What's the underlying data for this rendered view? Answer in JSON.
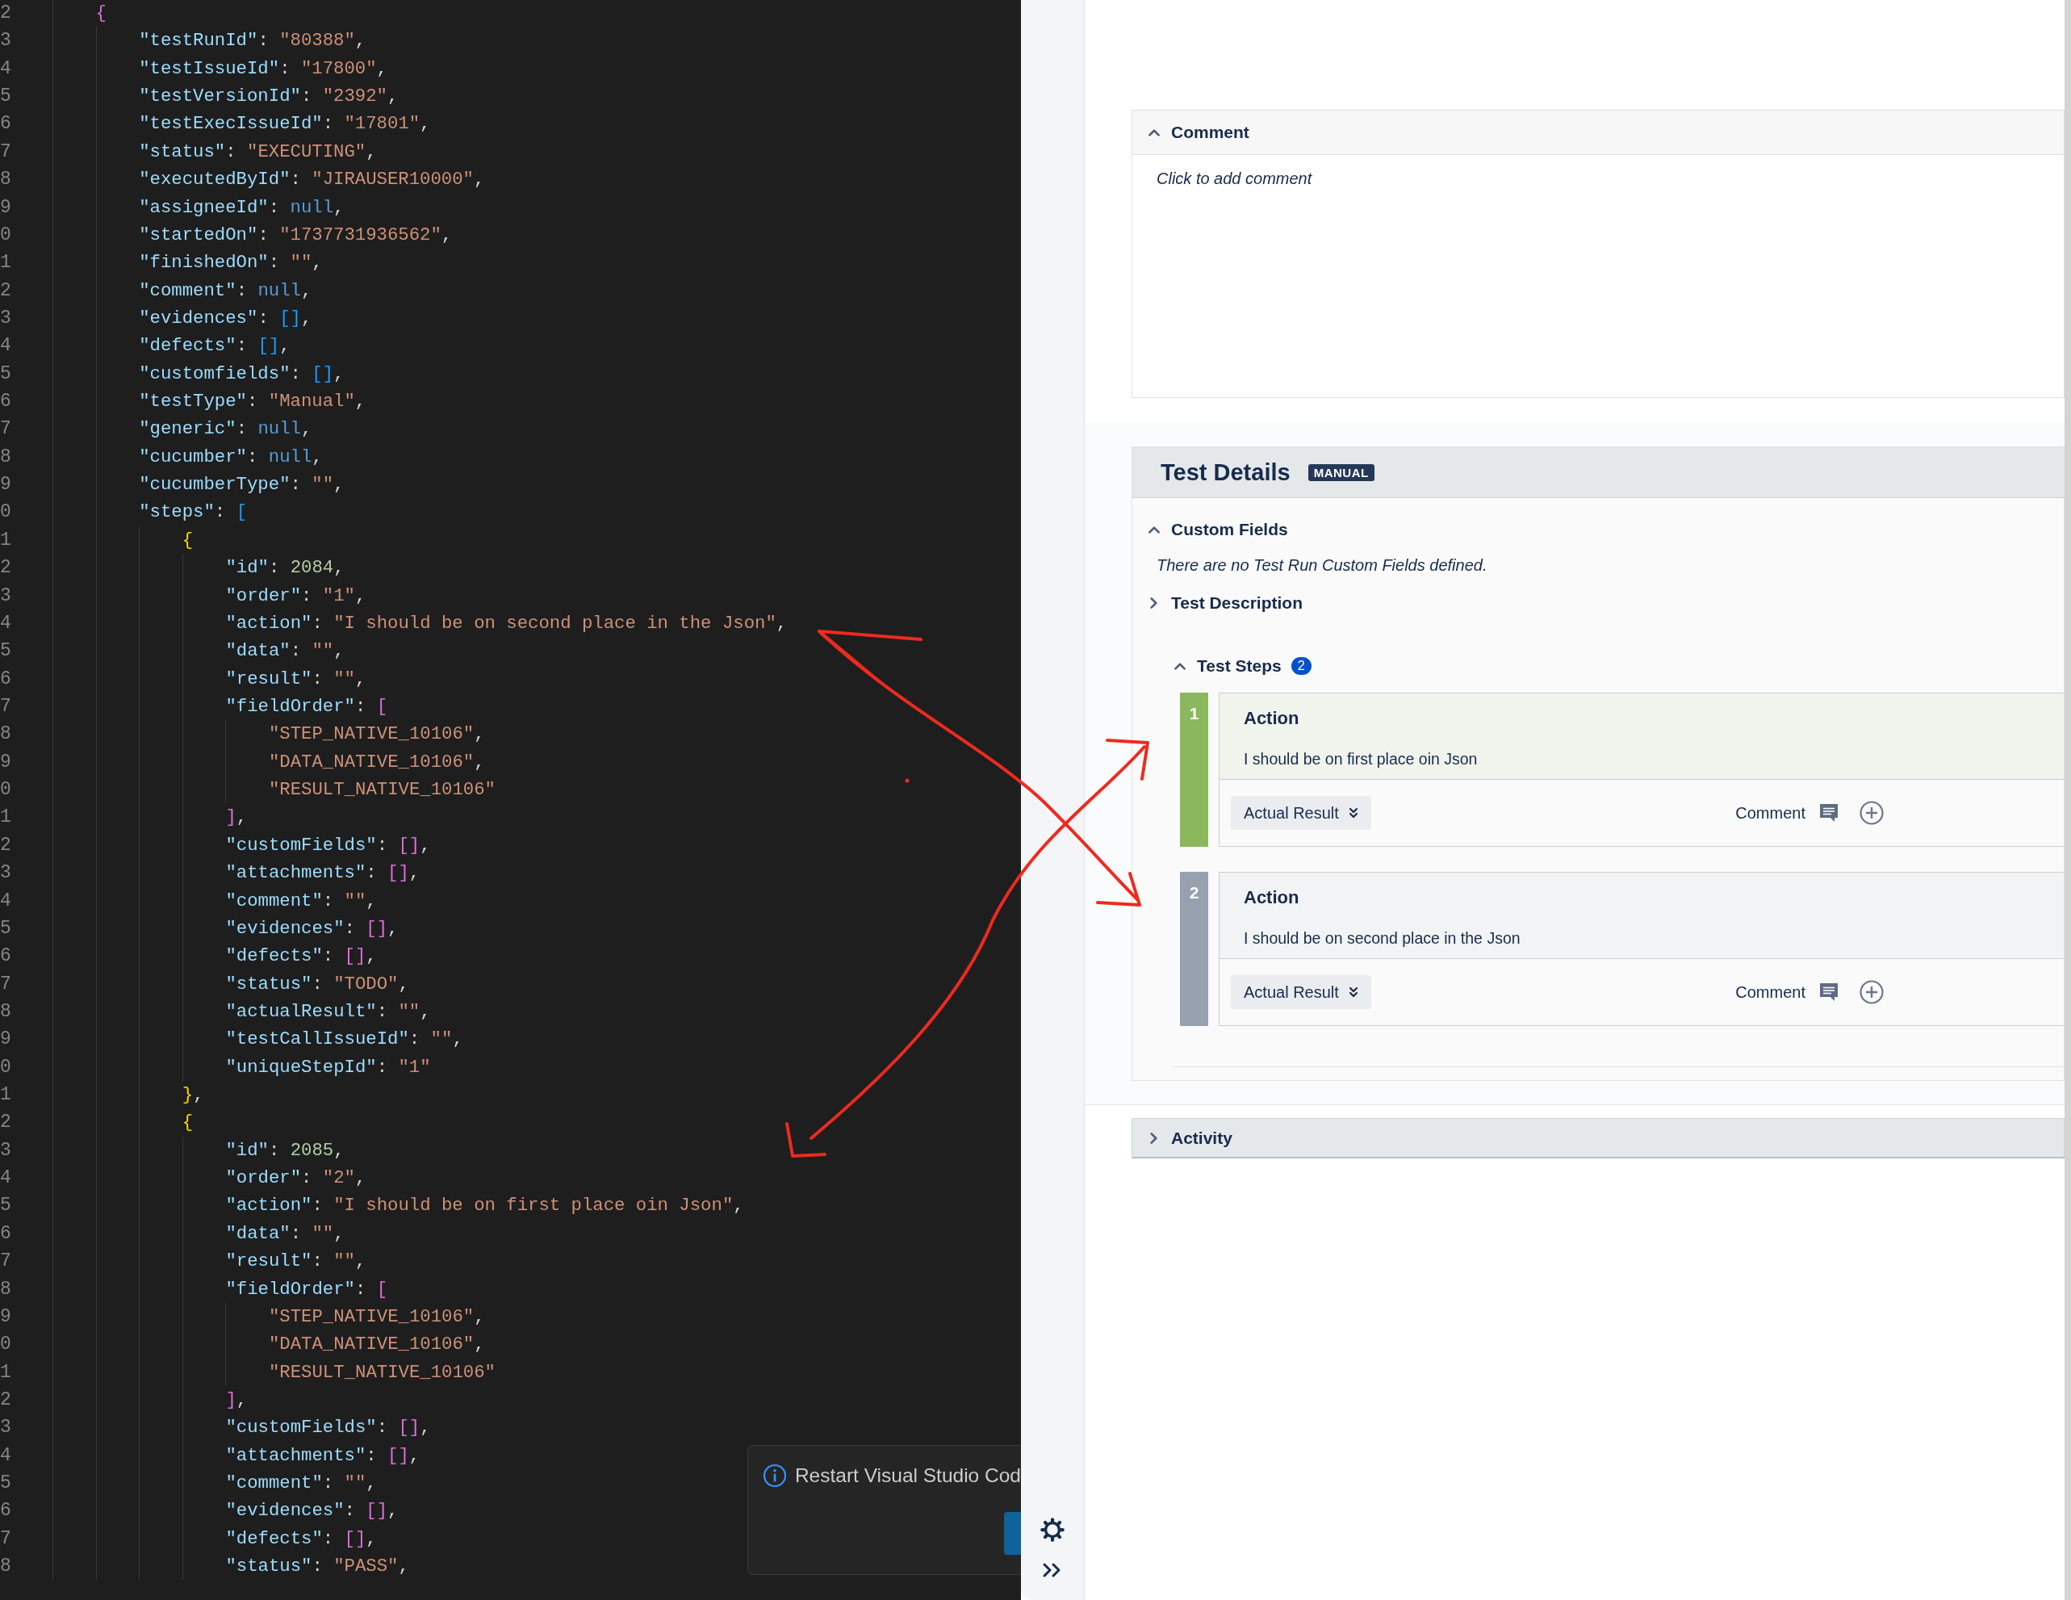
{
  "editor": {
    "lines": [
      {
        "number": "2",
        "tokens": [
          {
            "kind": "b1",
            "text": "{"
          }
        ],
        "children": [
          {
            "number": "3",
            "tokens": [
              {
                "kind": "key",
                "text": "\"testRunId\""
              },
              {
                "kind": "p",
                "text": ": "
              },
              {
                "kind": "str",
                "text": "\"80388\""
              },
              {
                "kind": "p",
                "text": ","
              }
            ]
          },
          {
            "number": "4",
            "tokens": [
              {
                "kind": "key",
                "text": "\"testIssueId\""
              },
              {
                "kind": "p",
                "text": ": "
              },
              {
                "kind": "str",
                "text": "\"17800\""
              },
              {
                "kind": "p",
                "text": ","
              }
            ]
          },
          {
            "number": "5",
            "tokens": [
              {
                "kind": "key",
                "text": "\"testVersionId\""
              },
              {
                "kind": "p",
                "text": ": "
              },
              {
                "kind": "str",
                "text": "\"2392\""
              },
              {
                "kind": "p",
                "text": ","
              }
            ]
          },
          {
            "number": "6",
            "tokens": [
              {
                "kind": "key",
                "text": "\"testExecIssueId\""
              },
              {
                "kind": "p",
                "text": ": "
              },
              {
                "kind": "str",
                "text": "\"17801\""
              },
              {
                "kind": "p",
                "text": ","
              }
            ]
          },
          {
            "number": "7",
            "tokens": [
              {
                "kind": "key",
                "text": "\"status\""
              },
              {
                "kind": "p",
                "text": ": "
              },
              {
                "kind": "str",
                "text": "\"EXECUTING\""
              },
              {
                "kind": "p",
                "text": ","
              }
            ]
          },
          {
            "number": "8",
            "tokens": [
              {
                "kind": "key",
                "text": "\"executedById\""
              },
              {
                "kind": "p",
                "text": ": "
              },
              {
                "kind": "str",
                "text": "\"JIRAUSER10000\""
              },
              {
                "kind": "p",
                "text": ","
              }
            ]
          },
          {
            "number": "9",
            "tokens": [
              {
                "kind": "key",
                "text": "\"assigneeId\""
              },
              {
                "kind": "p",
                "text": ": "
              },
              {
                "kind": "kw",
                "text": "null"
              },
              {
                "kind": "p",
                "text": ","
              }
            ]
          },
          {
            "number": "0",
            "tokens": [
              {
                "kind": "key",
                "text": "\"startedOn\""
              },
              {
                "kind": "p",
                "text": ": "
              },
              {
                "kind": "str",
                "text": "\"1737731936562\""
              },
              {
                "kind": "p",
                "text": ","
              }
            ]
          },
          {
            "number": "1",
            "tokens": [
              {
                "kind": "key",
                "text": "\"finishedOn\""
              },
              {
                "kind": "p",
                "text": ": "
              },
              {
                "kind": "str",
                "text": "\"\""
              },
              {
                "kind": "p",
                "text": ","
              }
            ]
          },
          {
            "number": "2",
            "tokens": [
              {
                "kind": "key",
                "text": "\"comment\""
              },
              {
                "kind": "p",
                "text": ": "
              },
              {
                "kind": "kw",
                "text": "null"
              },
              {
                "kind": "p",
                "text": ","
              }
            ]
          },
          {
            "number": "3",
            "tokens": [
              {
                "kind": "key",
                "text": "\"evidences\""
              },
              {
                "kind": "p",
                "text": ": "
              },
              {
                "kind": "b2",
                "text": "[]"
              },
              {
                "kind": "p",
                "text": ","
              }
            ]
          },
          {
            "number": "4",
            "tokens": [
              {
                "kind": "key",
                "text": "\"defects\""
              },
              {
                "kind": "p",
                "text": ": "
              },
              {
                "kind": "b2",
                "text": "[]"
              },
              {
                "kind": "p",
                "text": ","
              }
            ]
          },
          {
            "number": "5",
            "tokens": [
              {
                "kind": "key",
                "text": "\"customfields\""
              },
              {
                "kind": "p",
                "text": ": "
              },
              {
                "kind": "b2",
                "text": "[]"
              },
              {
                "kind": "p",
                "text": ","
              }
            ]
          },
          {
            "number": "6",
            "tokens": [
              {
                "kind": "key",
                "text": "\"testType\""
              },
              {
                "kind": "p",
                "text": ": "
              },
              {
                "kind": "str",
                "text": "\"Manual\""
              },
              {
                "kind": "p",
                "text": ","
              }
            ]
          },
          {
            "number": "7",
            "tokens": [
              {
                "kind": "key",
                "text": "\"generic\""
              },
              {
                "kind": "p",
                "text": ": "
              },
              {
                "kind": "kw",
                "text": "null"
              },
              {
                "kind": "p",
                "text": ","
              }
            ]
          },
          {
            "number": "8",
            "tokens": [
              {
                "kind": "key",
                "text": "\"cucumber\""
              },
              {
                "kind": "p",
                "text": ": "
              },
              {
                "kind": "kw",
                "text": "null"
              },
              {
                "kind": "p",
                "text": ","
              }
            ]
          },
          {
            "number": "9",
            "tokens": [
              {
                "kind": "key",
                "text": "\"cucumberType\""
              },
              {
                "kind": "p",
                "text": ": "
              },
              {
                "kind": "str",
                "text": "\"\""
              },
              {
                "kind": "p",
                "text": ","
              }
            ]
          },
          {
            "number": "0",
            "tokens": [
              {
                "kind": "key",
                "text": "\"steps\""
              },
              {
                "kind": "p",
                "text": ": "
              },
              {
                "kind": "b2",
                "text": "["
              }
            ],
            "children": [
              {
                "number": "1",
                "tokens": [
                  {
                    "kind": "b3",
                    "text": "{"
                  }
                ],
                "children": [
                  {
                    "number": "2",
                    "tokens": [
                      {
                        "kind": "key",
                        "text": "\"id\""
                      },
                      {
                        "kind": "p",
                        "text": ": "
                      },
                      {
                        "kind": "num",
                        "text": "2084"
                      },
                      {
                        "kind": "p",
                        "text": ","
                      }
                    ]
                  },
                  {
                    "number": "3",
                    "tokens": [
                      {
                        "kind": "key",
                        "text": "\"order\""
                      },
                      {
                        "kind": "p",
                        "text": ": "
                      },
                      {
                        "kind": "str",
                        "text": "\"1\""
                      },
                      {
                        "kind": "p",
                        "text": ","
                      }
                    ]
                  },
                  {
                    "number": "4",
                    "tokens": [
                      {
                        "kind": "key",
                        "text": "\"action\""
                      },
                      {
                        "kind": "p",
                        "text": ": "
                      },
                      {
                        "kind": "str",
                        "text": "\"I should be on second place in the Json\""
                      },
                      {
                        "kind": "p",
                        "text": ","
                      }
                    ]
                  },
                  {
                    "number": "5",
                    "tokens": [
                      {
                        "kind": "key",
                        "text": "\"data\""
                      },
                      {
                        "kind": "p",
                        "text": ": "
                      },
                      {
                        "kind": "str",
                        "text": "\"\""
                      },
                      {
                        "kind": "p",
                        "text": ","
                      }
                    ]
                  },
                  {
                    "number": "6",
                    "tokens": [
                      {
                        "kind": "key",
                        "text": "\"result\""
                      },
                      {
                        "kind": "p",
                        "text": ": "
                      },
                      {
                        "kind": "str",
                        "text": "\"\""
                      },
                      {
                        "kind": "p",
                        "text": ","
                      }
                    ]
                  },
                  {
                    "number": "7",
                    "tokens": [
                      {
                        "kind": "key",
                        "text": "\"fieldOrder\""
                      },
                      {
                        "kind": "p",
                        "text": ": "
                      },
                      {
                        "kind": "b1",
                        "text": "["
                      }
                    ],
                    "children": [
                      {
                        "number": "8",
                        "tokens": [
                          {
                            "kind": "str",
                            "text": "\"STEP_NATIVE_10106\""
                          },
                          {
                            "kind": "p",
                            "text": ","
                          }
                        ]
                      },
                      {
                        "number": "9",
                        "tokens": [
                          {
                            "kind": "str",
                            "text": "\"DATA_NATIVE_10106\""
                          },
                          {
                            "kind": "p",
                            "text": ","
                          }
                        ]
                      },
                      {
                        "number": "0",
                        "tokens": [
                          {
                            "kind": "str",
                            "text": "\"RESULT_NATIVE_10106\""
                          }
                        ]
                      }
                    ]
                  },
                  {
                    "number": "1",
                    "tokens": [
                      {
                        "kind": "b1",
                        "text": "]"
                      },
                      {
                        "kind": "p",
                        "text": ","
                      }
                    ]
                  },
                  {
                    "number": "2",
                    "tokens": [
                      {
                        "kind": "key",
                        "text": "\"customFields\""
                      },
                      {
                        "kind": "p",
                        "text": ": "
                      },
                      {
                        "kind": "b1",
                        "text": "[]"
                      },
                      {
                        "kind": "p",
                        "text": ","
                      }
                    ]
                  },
                  {
                    "number": "3",
                    "tokens": [
                      {
                        "kind": "key",
                        "text": "\"attachments\""
                      },
                      {
                        "kind": "p",
                        "text": ": "
                      },
                      {
                        "kind": "b1",
                        "text": "[]"
                      },
                      {
                        "kind": "p",
                        "text": ","
                      }
                    ]
                  },
                  {
                    "number": "4",
                    "tokens": [
                      {
                        "kind": "key",
                        "text": "\"comment\""
                      },
                      {
                        "kind": "p",
                        "text": ": "
                      },
                      {
                        "kind": "str",
                        "text": "\"\""
                      },
                      {
                        "kind": "p",
                        "text": ","
                      }
                    ]
                  },
                  {
                    "number": "5",
                    "tokens": [
                      {
                        "kind": "key",
                        "text": "\"evidences\""
                      },
                      {
                        "kind": "p",
                        "text": ": "
                      },
                      {
                        "kind": "b1",
                        "text": "[]"
                      },
                      {
                        "kind": "p",
                        "text": ","
                      }
                    ]
                  },
                  {
                    "number": "6",
                    "tokens": [
                      {
                        "kind": "key",
                        "text": "\"defects\""
                      },
                      {
                        "kind": "p",
                        "text": ": "
                      },
                      {
                        "kind": "b1",
                        "text": "[]"
                      },
                      {
                        "kind": "p",
                        "text": ","
                      }
                    ]
                  },
                  {
                    "number": "7",
                    "tokens": [
                      {
                        "kind": "key",
                        "text": "\"status\""
                      },
                      {
                        "kind": "p",
                        "text": ": "
                      },
                      {
                        "kind": "str",
                        "text": "\"TODO\""
                      },
                      {
                        "kind": "p",
                        "text": ","
                      }
                    ]
                  },
                  {
                    "number": "8",
                    "tokens": [
                      {
                        "kind": "key",
                        "text": "\"actualResult\""
                      },
                      {
                        "kind": "p",
                        "text": ": "
                      },
                      {
                        "kind": "str",
                        "text": "\"\""
                      },
                      {
                        "kind": "p",
                        "text": ","
                      }
                    ]
                  },
                  {
                    "number": "9",
                    "tokens": [
                      {
                        "kind": "key",
                        "text": "\"testCallIssueId\""
                      },
                      {
                        "kind": "p",
                        "text": ": "
                      },
                      {
                        "kind": "str",
                        "text": "\"\""
                      },
                      {
                        "kind": "p",
                        "text": ","
                      }
                    ]
                  },
                  {
                    "number": "0",
                    "tokens": [
                      {
                        "kind": "key",
                        "text": "\"uniqueStepId\""
                      },
                      {
                        "kind": "p",
                        "text": ": "
                      },
                      {
                        "kind": "str",
                        "text": "\"1\""
                      }
                    ]
                  }
                ]
              },
              {
                "number": "1",
                "tokens": [
                  {
                    "kind": "b3",
                    "text": "}"
                  },
                  {
                    "kind": "p",
                    "text": ","
                  }
                ]
              },
              {
                "number": "2",
                "tokens": [
                  {
                    "kind": "b3",
                    "text": "{"
                  }
                ],
                "children": [
                  {
                    "number": "3",
                    "tokens": [
                      {
                        "kind": "key",
                        "text": "\"id\""
                      },
                      {
                        "kind": "p",
                        "text": ": "
                      },
                      {
                        "kind": "num",
                        "text": "2085"
                      },
                      {
                        "kind": "p",
                        "text": ","
                      }
                    ]
                  },
                  {
                    "number": "4",
                    "tokens": [
                      {
                        "kind": "key",
                        "text": "\"order\""
                      },
                      {
                        "kind": "p",
                        "text": ": "
                      },
                      {
                        "kind": "str",
                        "text": "\"2\""
                      },
                      {
                        "kind": "p",
                        "text": ","
                      }
                    ]
                  },
                  {
                    "number": "5",
                    "tokens": [
                      {
                        "kind": "key",
                        "text": "\"action\""
                      },
                      {
                        "kind": "p",
                        "text": ": "
                      },
                      {
                        "kind": "str",
                        "text": "\"I should be on first place oin Json\""
                      },
                      {
                        "kind": "p",
                        "text": ","
                      }
                    ]
                  },
                  {
                    "number": "6",
                    "tokens": [
                      {
                        "kind": "key",
                        "text": "\"data\""
                      },
                      {
                        "kind": "p",
                        "text": ": "
                      },
                      {
                        "kind": "str",
                        "text": "\"\""
                      },
                      {
                        "kind": "p",
                        "text": ","
                      }
                    ]
                  },
                  {
                    "number": "7",
                    "tokens": [
                      {
                        "kind": "key",
                        "text": "\"result\""
                      },
                      {
                        "kind": "p",
                        "text": ": "
                      },
                      {
                        "kind": "str",
                        "text": "\"\""
                      },
                      {
                        "kind": "p",
                        "text": ","
                      }
                    ]
                  },
                  {
                    "number": "8",
                    "tokens": [
                      {
                        "kind": "key",
                        "text": "\"fieldOrder\""
                      },
                      {
                        "kind": "p",
                        "text": ": "
                      },
                      {
                        "kind": "b1",
                        "text": "["
                      }
                    ],
                    "children": [
                      {
                        "number": "9",
                        "tokens": [
                          {
                            "kind": "str",
                            "text": "\"STEP_NATIVE_10106\""
                          },
                          {
                            "kind": "p",
                            "text": ","
                          }
                        ]
                      },
                      {
                        "number": "0",
                        "tokens": [
                          {
                            "kind": "str",
                            "text": "\"DATA_NATIVE_10106\""
                          },
                          {
                            "kind": "p",
                            "text": ","
                          }
                        ]
                      },
                      {
                        "number": "1",
                        "tokens": [
                          {
                            "kind": "str",
                            "text": "\"RESULT_NATIVE_10106\""
                          }
                        ]
                      }
                    ]
                  },
                  {
                    "number": "2",
                    "tokens": [
                      {
                        "kind": "b1",
                        "text": "]"
                      },
                      {
                        "kind": "p",
                        "text": ","
                      }
                    ]
                  },
                  {
                    "number": "3",
                    "tokens": [
                      {
                        "kind": "key",
                        "text": "\"customFields\""
                      },
                      {
                        "kind": "p",
                        "text": ": "
                      },
                      {
                        "kind": "b1",
                        "text": "[]"
                      },
                      {
                        "kind": "p",
                        "text": ","
                      }
                    ]
                  },
                  {
                    "number": "4",
                    "tokens": [
                      {
                        "kind": "key",
                        "text": "\"attachments\""
                      },
                      {
                        "kind": "p",
                        "text": ": "
                      },
                      {
                        "kind": "b1",
                        "text": "[]"
                      },
                      {
                        "kind": "p",
                        "text": ","
                      }
                    ]
                  },
                  {
                    "number": "5",
                    "tokens": [
                      {
                        "kind": "key",
                        "text": "\"comment\""
                      },
                      {
                        "kind": "p",
                        "text": ": "
                      },
                      {
                        "kind": "str",
                        "text": "\"\""
                      },
                      {
                        "kind": "p",
                        "text": ","
                      }
                    ]
                  },
                  {
                    "number": "6",
                    "tokens": [
                      {
                        "kind": "key",
                        "text": "\"evidences\""
                      },
                      {
                        "kind": "p",
                        "text": ": "
                      },
                      {
                        "kind": "b1",
                        "text": "[]"
                      },
                      {
                        "kind": "p",
                        "text": ","
                      }
                    ]
                  },
                  {
                    "number": "7",
                    "tokens": [
                      {
                        "kind": "key",
                        "text": "\"defects\""
                      },
                      {
                        "kind": "p",
                        "text": ": "
                      },
                      {
                        "kind": "b1",
                        "text": "[]"
                      },
                      {
                        "kind": "p",
                        "text": ","
                      }
                    ]
                  },
                  {
                    "number": "8",
                    "tokens": [
                      {
                        "kind": "key",
                        "text": "\"status\""
                      },
                      {
                        "kind": "p",
                        "text": ": "
                      },
                      {
                        "kind": "str",
                        "text": "\"PASS\""
                      },
                      {
                        "kind": "p",
                        "text": ","
                      }
                    ]
                  }
                ]
              }
            ]
          }
        ]
      }
    ],
    "toast": {
      "message": "Restart Visual Studio Cod"
    }
  },
  "panel": {
    "comment": {
      "title": "Comment",
      "expanded": true,
      "prompt": "Click to add comment"
    },
    "test_details": {
      "title": "Test Details",
      "badge": "MANUAL",
      "sections": [
        {
          "title": "Custom Fields",
          "expanded": true,
          "text": "There are no Test Run Custom Fields defined."
        },
        {
          "title": "Test Description",
          "expanded": false
        }
      ],
      "test_steps": {
        "title": "Test Steps",
        "count": "2",
        "expanded": true,
        "steps": [
          {
            "number": "1",
            "color": "#8bb85c",
            "heading": "Action",
            "text": "I should be on first place oin Json",
            "actual_result": "Actual Result",
            "comment": "Comment"
          },
          {
            "number": "2",
            "color": "#97a0af",
            "heading": "Action",
            "text": "I should be on second place in the Json",
            "actual_result": "Actual Result",
            "comment": "Comment"
          }
        ]
      }
    },
    "activity": {
      "title": "Activity",
      "expanded": false
    }
  }
}
